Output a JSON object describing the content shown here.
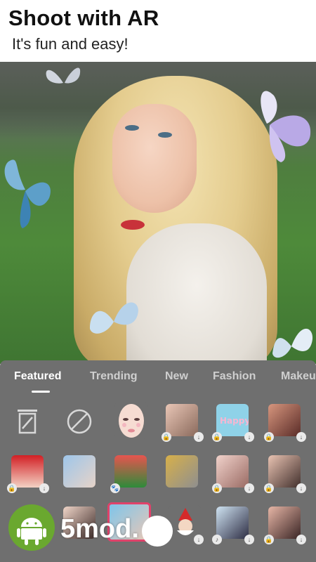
{
  "header": {
    "title": "Shoot with AR",
    "subtitle": "It's fun and easy!"
  },
  "tabs": [
    {
      "label": "Featured",
      "active": true
    },
    {
      "label": "Trending",
      "active": false
    },
    {
      "label": "New",
      "active": false
    },
    {
      "label": "Fashion",
      "active": false
    },
    {
      "label": "Makeu",
      "active": false
    }
  ],
  "tools": [
    {
      "icon": "eraser-icon"
    },
    {
      "icon": "no-effect-icon"
    }
  ],
  "watermark": {
    "text": "5mod."
  },
  "colors": {
    "panel": "#6f6f6f",
    "accent": "#ffffff",
    "android": "#6aa82f"
  }
}
